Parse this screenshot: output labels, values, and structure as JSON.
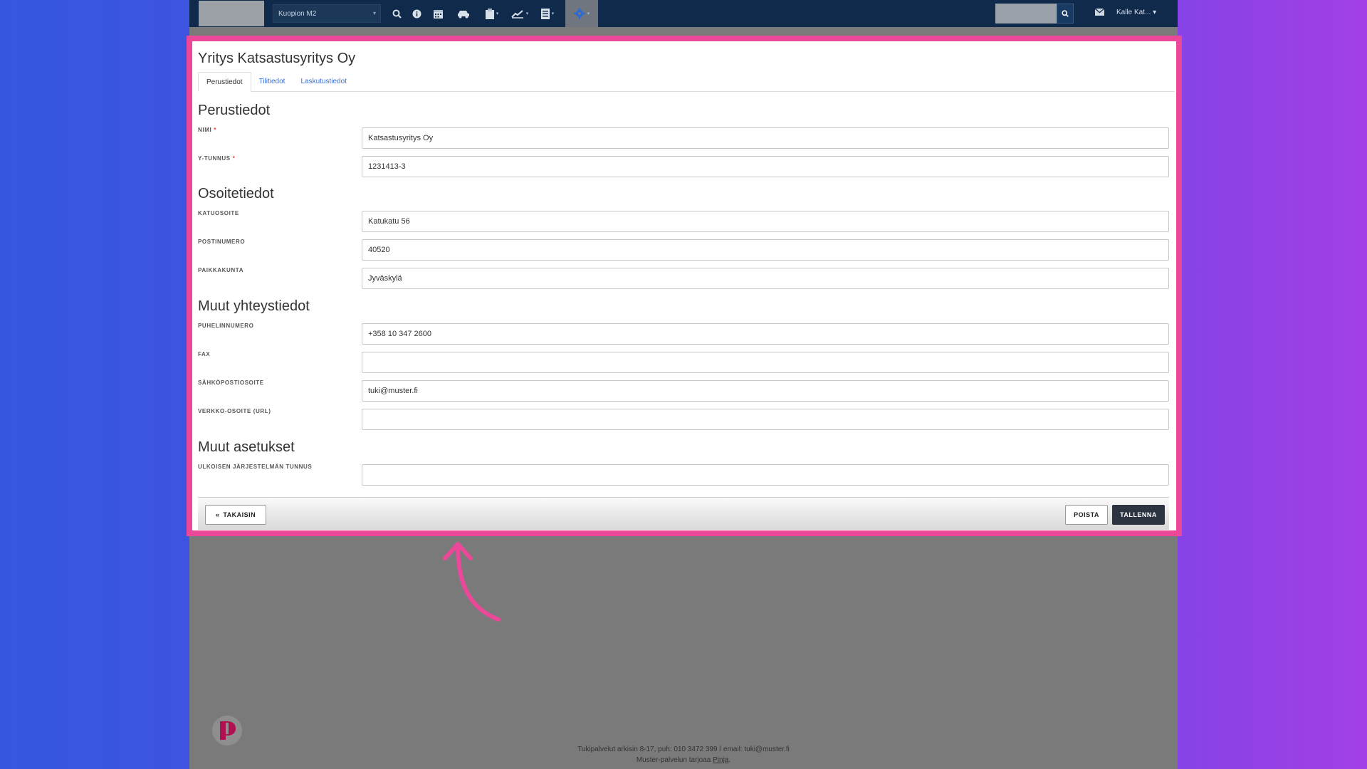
{
  "topbar": {
    "location": "Kuopion M2",
    "icons": [
      "search-icon",
      "info-icon",
      "calendar-icon",
      "car-icon",
      "clipboard-icon",
      "chart-icon",
      "document-icon",
      "gear-icon"
    ],
    "user_name": "Kalle Kat..."
  },
  "page": {
    "title": "Yritys Katsastusyritys Oy",
    "tabs": [
      {
        "label": "Perustiedot",
        "active": true
      },
      {
        "label": "Tilitiedot",
        "active": false
      },
      {
        "label": "Laskutustiedot",
        "active": false
      }
    ]
  },
  "sections": {
    "basic": {
      "title": "Perustiedot",
      "name_label": "NIMI",
      "name_value": "Katsastusyritys Oy",
      "business_id_label": "Y-TUNNUS",
      "business_id_value": "1231413-3"
    },
    "address": {
      "title": "Osoitetiedot",
      "street_label": "KATUOSOITE",
      "street_value": "Katukatu 56",
      "postal_label": "POSTINUMERO",
      "postal_value": "40520",
      "city_label": "PAIKKAKUNTA",
      "city_value": "Jyväskylä"
    },
    "contact": {
      "title": "Muut yhteystiedot",
      "phone_label": "PUHELINNUMERO",
      "phone_value": "+358 10 347 2600",
      "fax_label": "FAX",
      "fax_value": "",
      "email_label": "SÄHKÖPOSTIOSOITE",
      "email_value": "tuki@muster.fi",
      "url_label": "VERKKO-OSOITE (URL)",
      "url_value": ""
    },
    "other": {
      "title": "Muut asetukset",
      "external_id_label": "ULKOISEN JÄRJESTELMÄN TUNNUS",
      "external_id_value": ""
    }
  },
  "actions": {
    "back": "TAKAISIN",
    "delete": "POISTA",
    "save": "TALLENNA"
  },
  "footer": {
    "line1": "Tukipalvelut arkisin 8-17, puh: 010 3472 399 / email: tuki@muster.fi",
    "line2_prefix": "Muster-palvelun tarjoaa ",
    "line2_link": "Pinja",
    "line2_suffix": "."
  },
  "colors": {
    "highlight": "#ec4899",
    "topbar": "#0f2a4a",
    "save_button": "#2b3440",
    "tab_link": "#3a6fd8"
  }
}
